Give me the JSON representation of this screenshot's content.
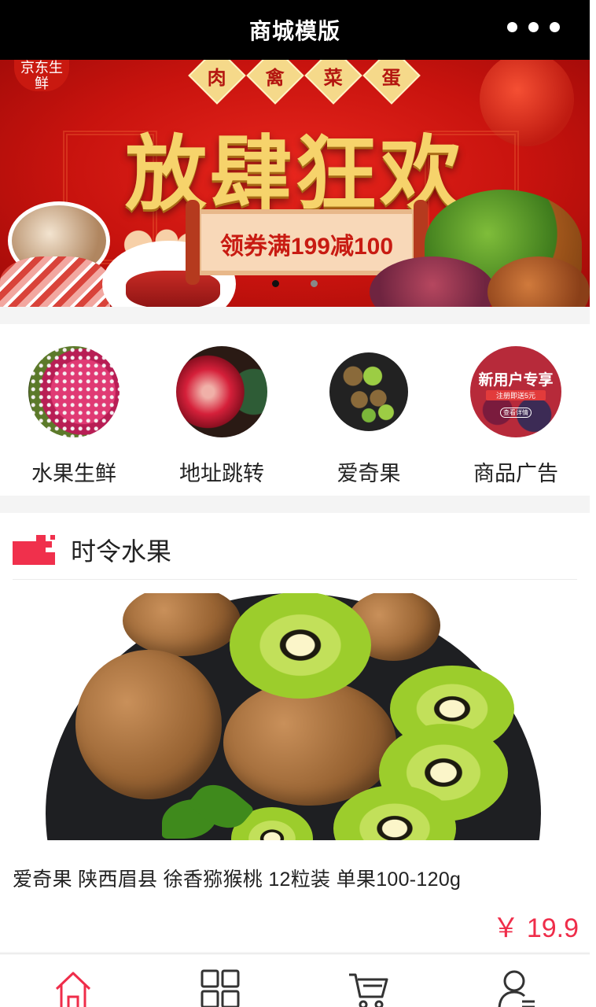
{
  "header": {
    "title": "商城模版"
  },
  "banner": {
    "top_tags": [
      "肉",
      "禽",
      "菜",
      "蛋"
    ],
    "corner_tag": "京东生鲜",
    "headline": "放肆狂欢",
    "coupon": "领券满199减100",
    "active_slide": 1,
    "slide_count": 2
  },
  "categories": [
    {
      "label": "水果生鲜",
      "icon": "dragon-fruit-image"
    },
    {
      "label": "地址跳转",
      "icon": "apple-image"
    },
    {
      "label": "爱奇果",
      "icon": "kiwi-image"
    },
    {
      "label": "商品广告",
      "icon": "new-user-promo-image",
      "promo_title": "新用户专享",
      "promo_sub": "注册即送5元",
      "promo_btn": "查看详情"
    }
  ],
  "section": {
    "title": "时令水果",
    "product": {
      "name": "爱奇果 陕西眉县 徐香猕猴桃 12粒装 单果100-120g",
      "price": "￥ 19.9"
    }
  },
  "bottom_nav": [
    {
      "name": "home",
      "icon": "home-icon",
      "active": true
    },
    {
      "name": "category",
      "icon": "grid-icon",
      "active": false
    },
    {
      "name": "cart",
      "icon": "cart-icon",
      "active": false
    },
    {
      "name": "profile",
      "icon": "user-icon",
      "active": false
    }
  ],
  "colors": {
    "accent": "#ef2d4a",
    "header_bg": "#000000"
  }
}
